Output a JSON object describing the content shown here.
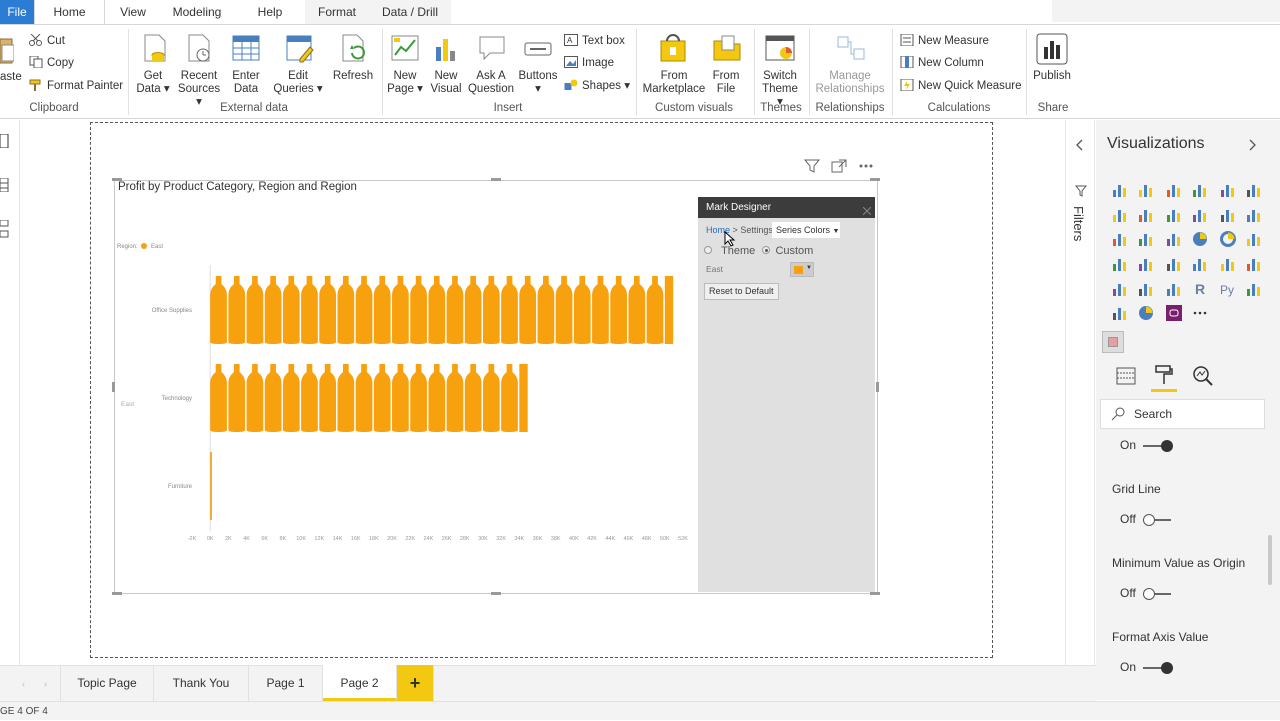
{
  "ribbon_tabs": {
    "file": "File",
    "home": "Home",
    "view": "View",
    "modeling": "Modeling",
    "help": "Help",
    "format": "Format",
    "data_drill": "Data / Drill"
  },
  "clipboard": {
    "paste": "aste",
    "cut": "Cut",
    "copy": "Copy",
    "format_painter": "Format Painter",
    "group": "Clipboard"
  },
  "external_data": {
    "get_data": "Get\nData ▾",
    "recent_sources": "Recent\nSources ▾",
    "enter_data": "Enter\nData",
    "edit_queries": "Edit\nQueries ▾",
    "refresh": "Refresh",
    "group": "External data"
  },
  "insert": {
    "new_page": "New\nPage ▾",
    "new_visual": "New\nVisual",
    "ask_question": "Ask A\nQuestion",
    "buttons": "Buttons\n▾",
    "text_box": "Text box",
    "image": "Image",
    "shapes": "Shapes ▾",
    "group": "Insert"
  },
  "custom_visuals": {
    "from_marketplace": "From\nMarketplace",
    "from_file": "From\nFile",
    "group": "Custom visuals"
  },
  "themes": {
    "switch_theme": "Switch\nTheme ▾",
    "group": "Themes"
  },
  "relationships": {
    "manage": "Manage\nRelationships",
    "group": "Relationships"
  },
  "calculations": {
    "new_measure": "New Measure",
    "new_column": "New Column",
    "new_quick_measure": "New Quick Measure",
    "group": "Calculations"
  },
  "share": {
    "publish": "Publish",
    "group": "Share"
  },
  "visual": {
    "title": "Profit by Product Category, Region and Region",
    "legend_label": "Region:",
    "legend_item": "East",
    "row_group_label": "East"
  },
  "chart_data": {
    "type": "bar",
    "categories": [
      "Office Supplies",
      "Technology",
      "Furniture"
    ],
    "series": [
      {
        "name": "East",
        "values": [
          51000,
          35000,
          200
        ]
      }
    ],
    "x_ticks": [
      "-2K",
      "0K",
      "2K",
      "4K",
      "6K",
      "8K",
      "10K",
      "12K",
      "14K",
      "16K",
      "18K",
      "20K",
      "22K",
      "24K",
      "26K",
      "28K",
      "30K",
      "32K",
      "34K",
      "36K",
      "38K",
      "40K",
      "42K",
      "44K",
      "46K",
      "48K",
      "50K",
      "52K"
    ],
    "xlim": [
      -2000,
      52000
    ],
    "mark": "bottle-pictograph",
    "color": "#f7a10f",
    "legend_position": "top-left"
  },
  "mark_designer": {
    "title": "Mark Designer",
    "breadcrumb_home": "Home",
    "breadcrumb_sep": ">",
    "breadcrumb_settings": "Settings",
    "dropdown": "Series Colors",
    "radio_theme": "Theme",
    "radio_custom": "Custom",
    "series_label": "East",
    "reset": "Reset to Default"
  },
  "filters": {
    "label": "Filters"
  },
  "visualizations": {
    "title": "Visualizations",
    "search_placeholder": "Search",
    "toggle_top": "On",
    "grid_line_label": "Grid Line",
    "grid_line_value": "Off",
    "min_origin_label": "Minimum Value as Origin",
    "min_origin_value": "Off",
    "format_axis_label": "Format Axis Value",
    "format_axis_value": "On"
  },
  "page_tabs": {
    "topic": "Topic Page",
    "thank_you": "Thank You",
    "page1": "Page 1",
    "page2": "Page 2",
    "add": "+"
  },
  "status": {
    "text": "GE 4 OF 4"
  },
  "colors": {
    "accent": "#2b7cd3",
    "bar": "#f7a10f",
    "tab_highlight": "#f2c811"
  }
}
